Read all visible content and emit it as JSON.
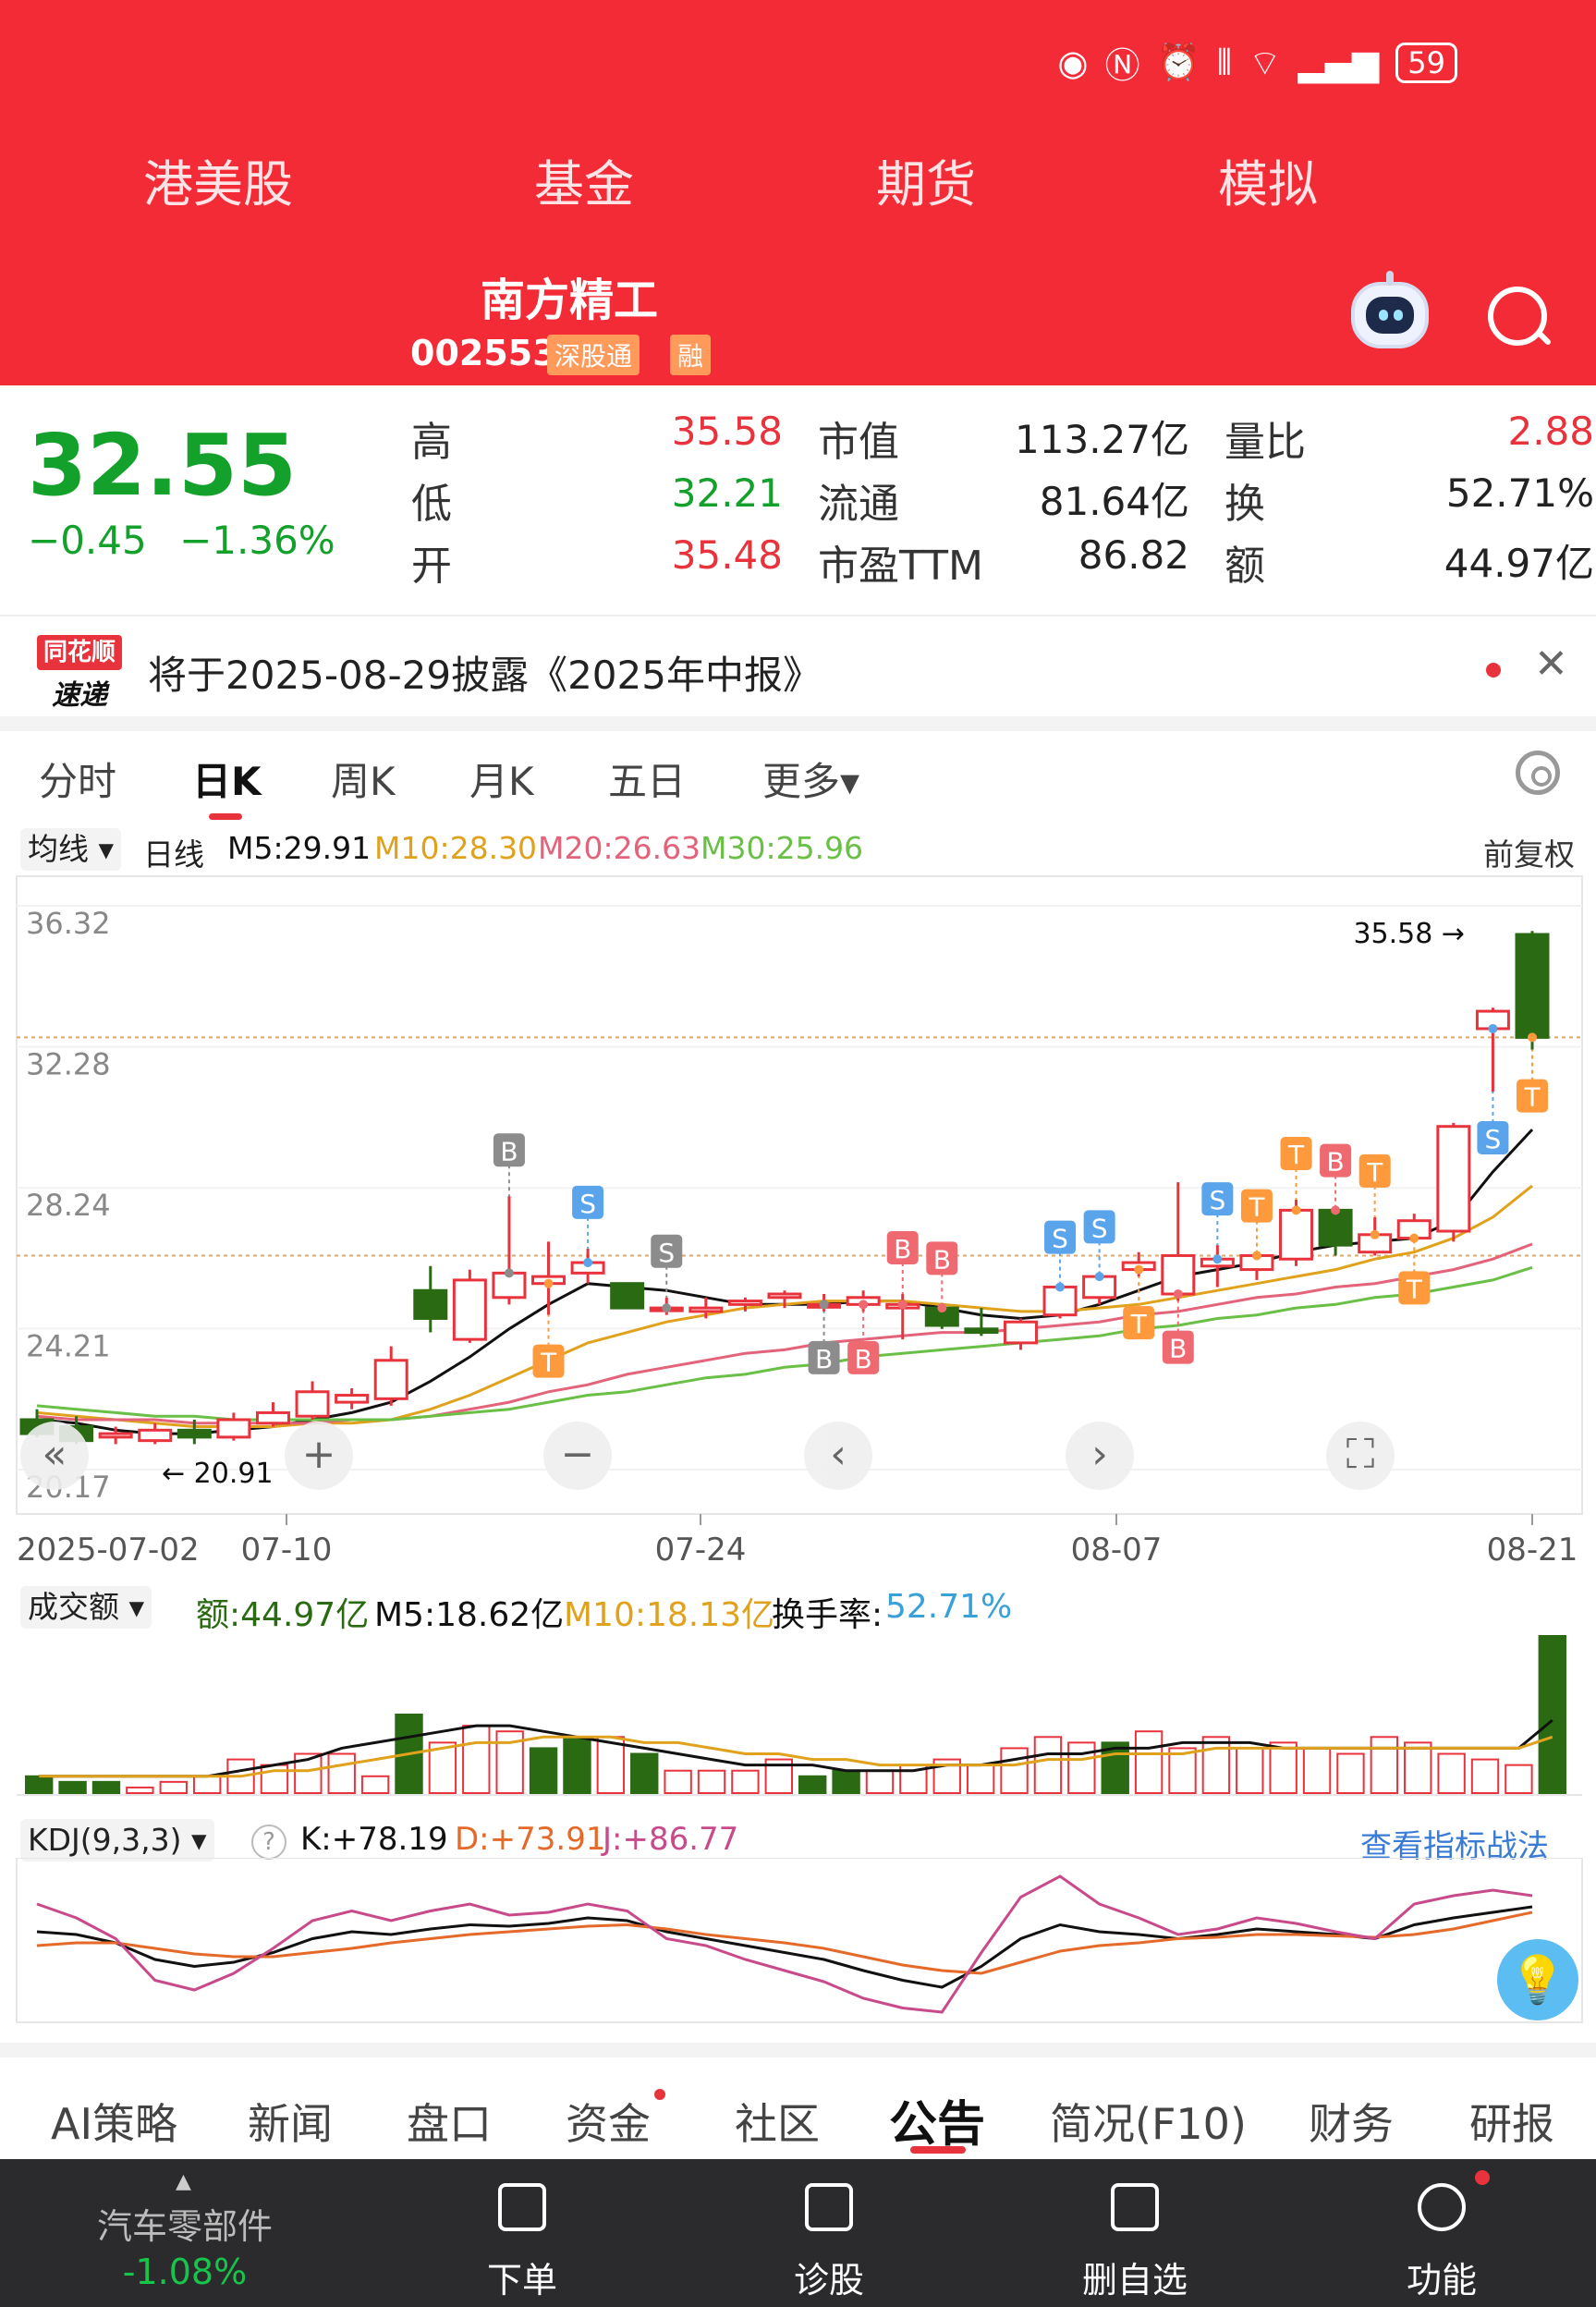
{
  "status_bar": {
    "battery": "59"
  },
  "top_nav": [
    "港美股",
    "基金",
    "期货",
    "模拟"
  ],
  "stock": {
    "name": "南方精工",
    "code": "002553",
    "tag_connect": "深股通",
    "tag_margin": "融"
  },
  "quote": {
    "price": "32.55",
    "change": "−0.45",
    "change_pct": "−1.36%",
    "rows": [
      {
        "l1": "高",
        "v1": "35.58",
        "l2": "市值",
        "v2": "113.27亿",
        "l3": "量比",
        "v3": "2.88"
      },
      {
        "l1": "低",
        "v1": "32.21",
        "l2": "流通",
        "v2": "81.64亿",
        "l3": "换",
        "v3": "52.71%"
      },
      {
        "l1": "开",
        "v1": "35.48",
        "l2": "市盈TTM",
        "v2": "86.82",
        "l3": "额",
        "v3": "44.97亿"
      }
    ]
  },
  "notice": {
    "logo_top": "同花顺",
    "logo_bottom": "速递",
    "text": "将于2025-08-29披露《2025年中报》"
  },
  "chart_tabs": [
    "分时",
    "日K",
    "周K",
    "月K",
    "五日",
    "更多▾"
  ],
  "ma_legend": {
    "label": "均线",
    "period": "日线",
    "m5": "M5:29.91",
    "m10": "M10:28.30",
    "m20": "M20:26.63",
    "m30": "M30:25.96",
    "adjust": "前复权"
  },
  "colors": {
    "up": "#e8333c",
    "down": "#2a6a12",
    "m5": "#111111",
    "m10": "#e0a21c",
    "m20": "#e2637a",
    "m30": "#6abf47"
  },
  "chart_data": {
    "type": "candlestick",
    "y_axis_ticks": [
      "36.32",
      "32.28",
      "28.24",
      "24.21",
      "20.17"
    ],
    "ylim": [
      20.17,
      36.32
    ],
    "x_axis_ticks": [
      "2025-07-02",
      "07-10",
      "07-24",
      "08-07",
      "08-21"
    ],
    "high_label": "35.58",
    "low_label": "20.91",
    "candles": [
      {
        "o": 21.6,
        "h": 21.9,
        "l": 21.1,
        "c": 21.2
      },
      {
        "o": 21.4,
        "h": 21.7,
        "l": 20.9,
        "c": 21.0
      },
      {
        "o": 21.1,
        "h": 21.4,
        "l": 20.9,
        "c": 21.2
      },
      {
        "o": 21.0,
        "h": 21.5,
        "l": 20.9,
        "c": 21.3
      },
      {
        "o": 21.3,
        "h": 21.6,
        "l": 20.9,
        "c": 21.1
      },
      {
        "o": 21.1,
        "h": 21.8,
        "l": 21.0,
        "c": 21.6
      },
      {
        "o": 21.5,
        "h": 22.1,
        "l": 21.4,
        "c": 21.8
      },
      {
        "o": 21.7,
        "h": 22.7,
        "l": 21.6,
        "c": 22.4
      },
      {
        "o": 22.1,
        "h": 22.5,
        "l": 21.9,
        "c": 22.3
      },
      {
        "o": 22.2,
        "h": 23.7,
        "l": 22.0,
        "c": 23.3
      },
      {
        "o": 25.3,
        "h": 26.0,
        "l": 24.1,
        "c": 24.5
      },
      {
        "o": 23.9,
        "h": 25.9,
        "l": 23.8,
        "c": 25.6
      },
      {
        "o": 25.1,
        "h": 28.0,
        "l": 24.9,
        "c": 25.8
      },
      {
        "o": 25.5,
        "h": 26.7,
        "l": 24.6,
        "c": 25.7
      },
      {
        "o": 25.8,
        "h": 26.5,
        "l": 25.5,
        "c": 26.1
      },
      {
        "o": 25.5,
        "h": 25.5,
        "l": 24.8,
        "c": 24.8
      },
      {
        "o": 24.8,
        "h": 25.1,
        "l": 24.6,
        "c": 24.8
      },
      {
        "o": 24.7,
        "h": 25.1,
        "l": 24.5,
        "c": 24.8
      },
      {
        "o": 24.9,
        "h": 25.1,
        "l": 24.7,
        "c": 25.0
      },
      {
        "o": 25.1,
        "h": 25.3,
        "l": 24.8,
        "c": 25.2
      },
      {
        "o": 24.9,
        "h": 25.2,
        "l": 24.7,
        "c": 24.9
      },
      {
        "o": 24.9,
        "h": 25.3,
        "l": 24.7,
        "c": 25.1
      },
      {
        "o": 24.8,
        "h": 25.2,
        "l": 23.9,
        "c": 24.9
      },
      {
        "o": 24.8,
        "h": 24.9,
        "l": 24.2,
        "c": 24.3
      },
      {
        "o": 24.2,
        "h": 24.8,
        "l": 24.0,
        "c": 24.1
      },
      {
        "o": 23.8,
        "h": 24.5,
        "l": 23.6,
        "c": 24.4
      },
      {
        "o": 24.6,
        "h": 25.5,
        "l": 24.5,
        "c": 25.4
      },
      {
        "o": 25.1,
        "h": 25.8,
        "l": 24.9,
        "c": 25.7
      },
      {
        "o": 25.9,
        "h": 26.4,
        "l": 25.7,
        "c": 26.1
      },
      {
        "o": 25.2,
        "h": 28.4,
        "l": 25.0,
        "c": 26.3
      },
      {
        "o": 26.0,
        "h": 26.6,
        "l": 25.4,
        "c": 26.2
      },
      {
        "o": 25.9,
        "h": 26.4,
        "l": 25.6,
        "c": 26.3
      },
      {
        "o": 26.2,
        "h": 27.9,
        "l": 26.0,
        "c": 27.6
      },
      {
        "o": 27.6,
        "h": 27.7,
        "l": 26.3,
        "c": 26.6
      },
      {
        "o": 26.4,
        "h": 27.4,
        "l": 26.3,
        "c": 26.9
      },
      {
        "o": 26.8,
        "h": 27.5,
        "l": 26.7,
        "c": 27.3
      },
      {
        "o": 27.0,
        "h": 30.1,
        "l": 26.7,
        "c": 30.0
      },
      {
        "o": 32.8,
        "h": 33.4,
        "l": 31.0,
        "c": 33.3
      },
      {
        "o": 35.5,
        "h": 35.6,
        "l": 32.2,
        "c": 32.55
      }
    ],
    "series": [
      {
        "name": "M5",
        "values": [
          21.6,
          21.5,
          21.3,
          21.2,
          21.2,
          21.3,
          21.4,
          21.6,
          21.8,
          22.1,
          22.7,
          23.4,
          24.2,
          24.9,
          25.5,
          25.4,
          25.3,
          25.1,
          24.9,
          24.9,
          24.9,
          25.0,
          25.0,
          24.8,
          24.6,
          24.5,
          24.6,
          24.9,
          25.3,
          25.7,
          25.9,
          26.1,
          26.4,
          26.6,
          26.7,
          26.8,
          27.3,
          28.7,
          29.91
        ]
      },
      {
        "name": "M10",
        "values": [
          21.8,
          21.7,
          21.6,
          21.5,
          21.4,
          21.4,
          21.4,
          21.5,
          21.5,
          21.6,
          21.9,
          22.3,
          22.8,
          23.3,
          23.8,
          24.1,
          24.4,
          24.6,
          24.8,
          24.9,
          25.0,
          25.0,
          25.0,
          24.9,
          24.8,
          24.7,
          24.7,
          24.8,
          24.9,
          25.1,
          25.3,
          25.5,
          25.7,
          25.9,
          26.2,
          26.4,
          26.8,
          27.4,
          28.3
        ]
      },
      {
        "name": "M20",
        "values": [
          21.7,
          21.6,
          21.6,
          21.6,
          21.5,
          21.5,
          21.5,
          21.5,
          21.6,
          21.6,
          21.7,
          21.9,
          22.1,
          22.4,
          22.6,
          22.9,
          23.1,
          23.3,
          23.5,
          23.6,
          23.8,
          23.9,
          24.0,
          24.1,
          24.1,
          24.2,
          24.3,
          24.4,
          24.6,
          24.7,
          24.9,
          25.1,
          25.2,
          25.4,
          25.5,
          25.7,
          25.9,
          26.2,
          26.63
        ]
      },
      {
        "name": "M30",
        "values": [
          22.0,
          21.9,
          21.8,
          21.7,
          21.7,
          21.6,
          21.6,
          21.6,
          21.6,
          21.6,
          21.7,
          21.8,
          21.9,
          22.1,
          22.3,
          22.4,
          22.6,
          22.8,
          22.9,
          23.1,
          23.2,
          23.4,
          23.5,
          23.6,
          23.7,
          23.8,
          23.9,
          24.0,
          24.2,
          24.3,
          24.5,
          24.6,
          24.8,
          24.9,
          25.1,
          25.2,
          25.4,
          25.6,
          25.96
        ]
      }
    ],
    "signals": [
      {
        "i": 12,
        "label": "B",
        "color": "#8c8c8c",
        "pos": "above"
      },
      {
        "i": 14,
        "label": "S",
        "color": "#5aa4ec",
        "pos": "above"
      },
      {
        "i": 13,
        "label": "T",
        "color": "#ff9a3c",
        "pos": "below"
      },
      {
        "i": 16,
        "label": "S",
        "color": "#8c8c8c",
        "pos": "above"
      },
      {
        "i": 20,
        "label": "B",
        "color": "#8c8c8c",
        "pos": "below"
      },
      {
        "i": 21,
        "label": "B",
        "color": "#ef6a70",
        "pos": "below"
      },
      {
        "i": 22,
        "label": "B",
        "color": "#ef6a70",
        "pos": "above"
      },
      {
        "i": 23,
        "label": "B",
        "color": "#ef6a70",
        "pos": "above"
      },
      {
        "i": 26,
        "label": "S",
        "color": "#5aa4ec",
        "pos": "above"
      },
      {
        "i": 27,
        "label": "S",
        "color": "#5aa4ec",
        "pos": "above"
      },
      {
        "i": 28,
        "label": "T",
        "color": "#ff9a3c",
        "pos": "below"
      },
      {
        "i": 29,
        "label": "B",
        "color": "#ef6a70",
        "pos": "below"
      },
      {
        "i": 30,
        "label": "S",
        "color": "#5aa4ec",
        "pos": "above"
      },
      {
        "i": 31,
        "label": "T",
        "color": "#ff9a3c",
        "pos": "above"
      },
      {
        "i": 32,
        "label": "T",
        "color": "#ff9a3c",
        "pos": "above"
      },
      {
        "i": 33,
        "label": "B",
        "color": "#ef6a70",
        "pos": "above"
      },
      {
        "i": 34,
        "label": "T",
        "color": "#ff9a3c",
        "pos": "above"
      },
      {
        "i": 35,
        "label": "T",
        "color": "#ff9a3c",
        "pos": "below"
      },
      {
        "i": 37,
        "label": "S",
        "color": "#5aa4ec",
        "pos": "below"
      },
      {
        "i": 38,
        "label": "T",
        "color": "#ff9a3c",
        "pos": "below"
      }
    ]
  },
  "volume": {
    "label": "成交额",
    "amount": "额:44.97亿",
    "m5": "M5:18.62亿",
    "m10": "M10:18.13亿",
    "turnover_label": "换手率:",
    "turnover": "52.71%",
    "bars": [
      3,
      2,
      2,
      1,
      2,
      3,
      6,
      5,
      7,
      7,
      3,
      14,
      9,
      12,
      11,
      8,
      10,
      10,
      7,
      4,
      4,
      4,
      6,
      3,
      4,
      4,
      5,
      6,
      5,
      8,
      10,
      9,
      9,
      11,
      8,
      10,
      8,
      9,
      8,
      7,
      10,
      9,
      7,
      6,
      5,
      28
    ],
    "m5_values": [
      3,
      3,
      3,
      3,
      3,
      3,
      4,
      5,
      6,
      8,
      9,
      10,
      11,
      12,
      12,
      11,
      10,
      9,
      8,
      7,
      6,
      5,
      5,
      5,
      4,
      4,
      4,
      5,
      5,
      6,
      7,
      7,
      8,
      8,
      9,
      9,
      9,
      8,
      8,
      8,
      8,
      8,
      8,
      8,
      8,
      13
    ],
    "m10_values": [
      3,
      3,
      3,
      3,
      3,
      3,
      3,
      4,
      4,
      5,
      6,
      7,
      8,
      9,
      9,
      10,
      10,
      10,
      9,
      9,
      8,
      7,
      7,
      6,
      6,
      5,
      5,
      5,
      5,
      5,
      6,
      6,
      7,
      7,
      7,
      8,
      8,
      8,
      8,
      8,
      8,
      8,
      8,
      8,
      8,
      10
    ]
  },
  "kdj": {
    "label": "KDJ(9,3,3)",
    "help": "?",
    "k": "K:+78.19",
    "d": "D:+73.91",
    "j": "J:+86.77",
    "link": "查看指标战法",
    "k_values": [
      60,
      58,
      52,
      40,
      35,
      38,
      45,
      55,
      60,
      58,
      62,
      65,
      64,
      66,
      70,
      68,
      60,
      55,
      50,
      45,
      40,
      32,
      25,
      20,
      35,
      55,
      65,
      60,
      58,
      55,
      58,
      62,
      60,
      58,
      55,
      65,
      70,
      74,
      78
    ],
    "d_values": [
      50,
      52,
      52,
      48,
      44,
      42,
      42,
      45,
      48,
      52,
      55,
      58,
      60,
      62,
      64,
      65,
      62,
      58,
      55,
      52,
      48,
      42,
      36,
      32,
      30,
      38,
      46,
      50,
      52,
      55,
      56,
      58,
      58,
      57,
      56,
      58,
      62,
      68,
      74
    ],
    "j_values": [
      80,
      70,
      55,
      25,
      18,
      30,
      48,
      68,
      75,
      68,
      75,
      80,
      72,
      74,
      80,
      75,
      55,
      50,
      40,
      32,
      24,
      12,
      5,
      2,
      45,
      85,
      100,
      80,
      70,
      58,
      62,
      70,
      66,
      60,
      55,
      80,
      86,
      90,
      86
    ]
  },
  "sub_tabs": [
    "AI策略",
    "新闻",
    "盘口",
    "资金",
    "社区",
    "公告",
    "简况(F10)",
    "财务",
    "研报"
  ],
  "bottom_bar": {
    "sector_name": "汽车零部件",
    "sector_change": "-1.08%",
    "items": [
      "下单",
      "诊股",
      "删自选",
      "功能"
    ]
  }
}
